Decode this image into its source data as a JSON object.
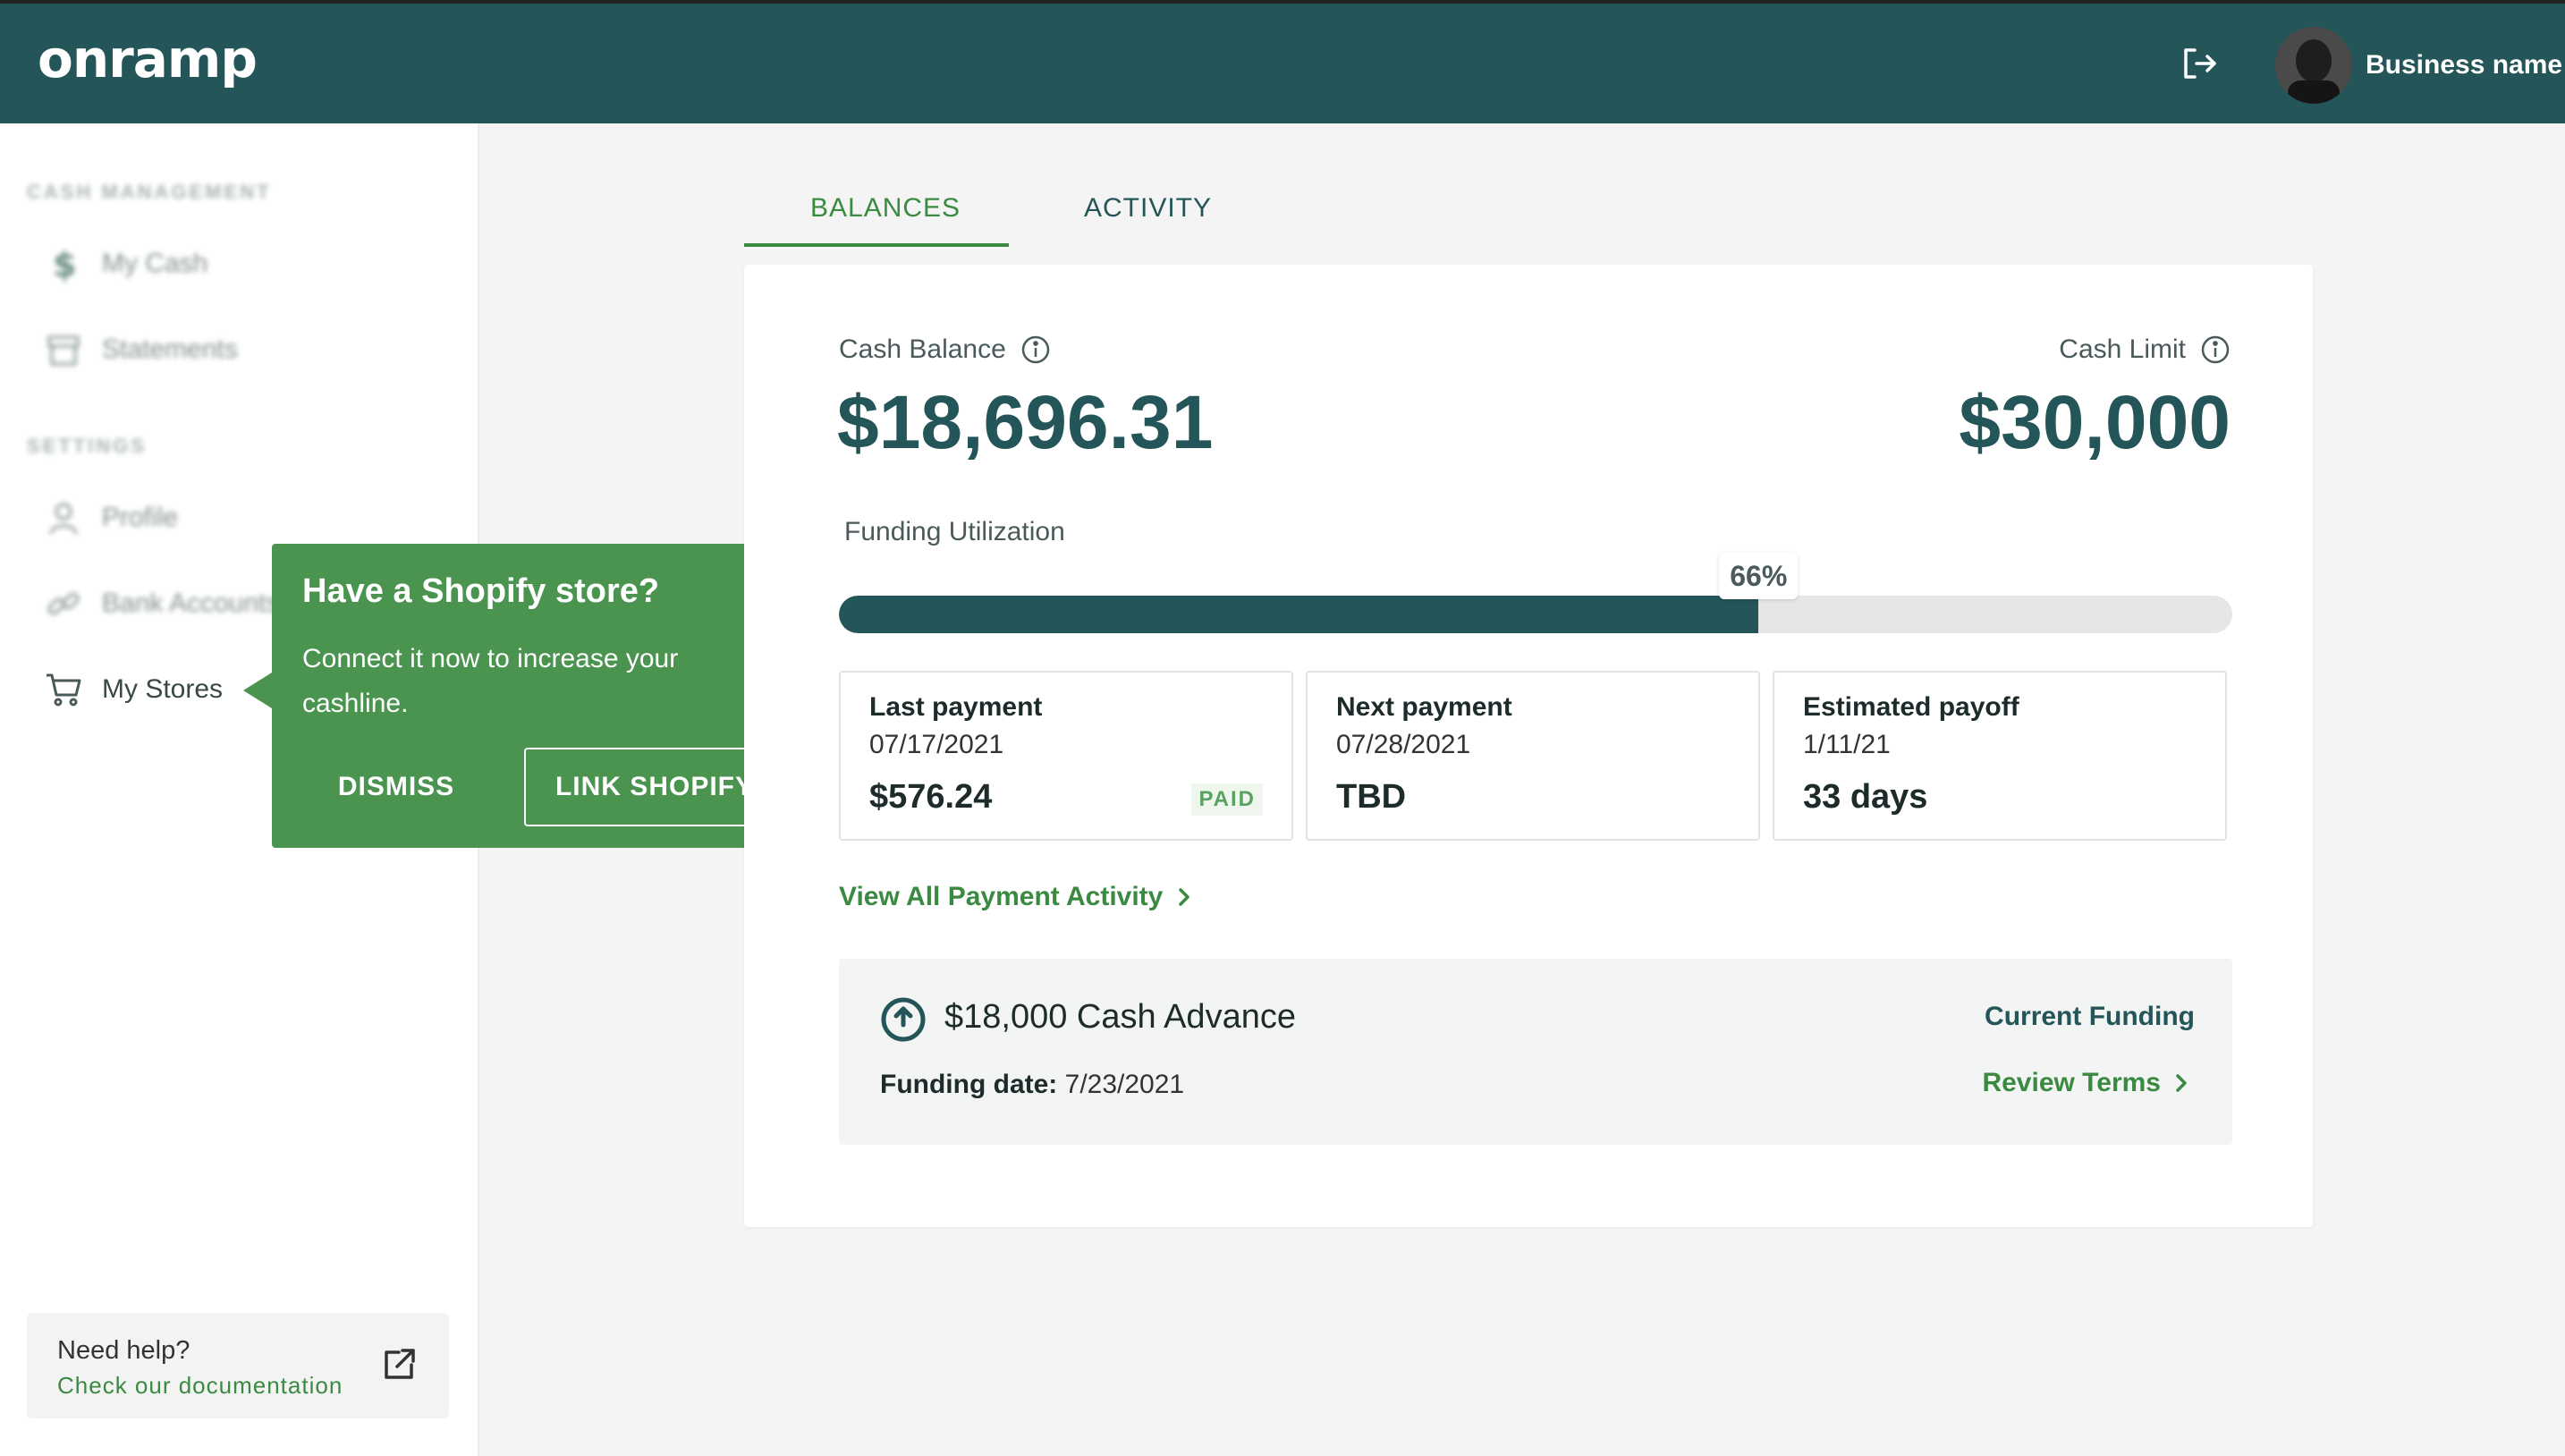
{
  "header": {
    "logo": "onramp",
    "business_name": "Business name",
    "brand_color": "#245558"
  },
  "sidebar": {
    "sections": [
      {
        "title": "CASH MANAGEMENT"
      },
      {
        "title": "SETTINGS"
      }
    ],
    "items": [
      {
        "label": "My Cash",
        "icon": "dollar-icon"
      },
      {
        "label": "Statements",
        "icon": "archive-icon"
      },
      {
        "label": "Profile",
        "icon": "user-icon"
      },
      {
        "label": "Bank Accounts",
        "icon": "link-icon"
      },
      {
        "label": "My Stores",
        "icon": "cart-icon"
      }
    ],
    "help": {
      "title": "Need help?",
      "link": "Check our documentation"
    }
  },
  "popover": {
    "title": "Have a Shopify store?",
    "body": "Connect it now to increase your cashline.",
    "dismiss_label": "DISMISS",
    "link_label": "LINK SHOPIFY",
    "color": "#4a9450"
  },
  "tabs": [
    {
      "label": "BALANCES",
      "active": true
    },
    {
      "label": "ACTIVITY",
      "active": false
    }
  ],
  "balances": {
    "cash_balance_label": "Cash Balance",
    "cash_balance": "$18,696.31",
    "cash_limit_label": "Cash Limit",
    "cash_limit": "$30,000",
    "funding_utilization_label": "Funding Utilization",
    "utilization_percent": 66,
    "utilization_text": "66%",
    "stats": [
      {
        "title": "Last payment",
        "date": "07/17/2021",
        "value": "$576.24",
        "badge": "PAID"
      },
      {
        "title": "Next payment",
        "date": "07/28/2021",
        "value": "TBD"
      },
      {
        "title": "Estimated payoff",
        "date": "1/11/21",
        "value": "33 days"
      }
    ],
    "view_all_label": "View All Payment Activity",
    "advance": {
      "title": "$18,000 Cash Advance",
      "funding_date_label": "Funding date:",
      "funding_date": "7/23/2021",
      "status": "Current Funding",
      "review_label": "Review Terms"
    },
    "accent_color": "#3b8a42"
  }
}
